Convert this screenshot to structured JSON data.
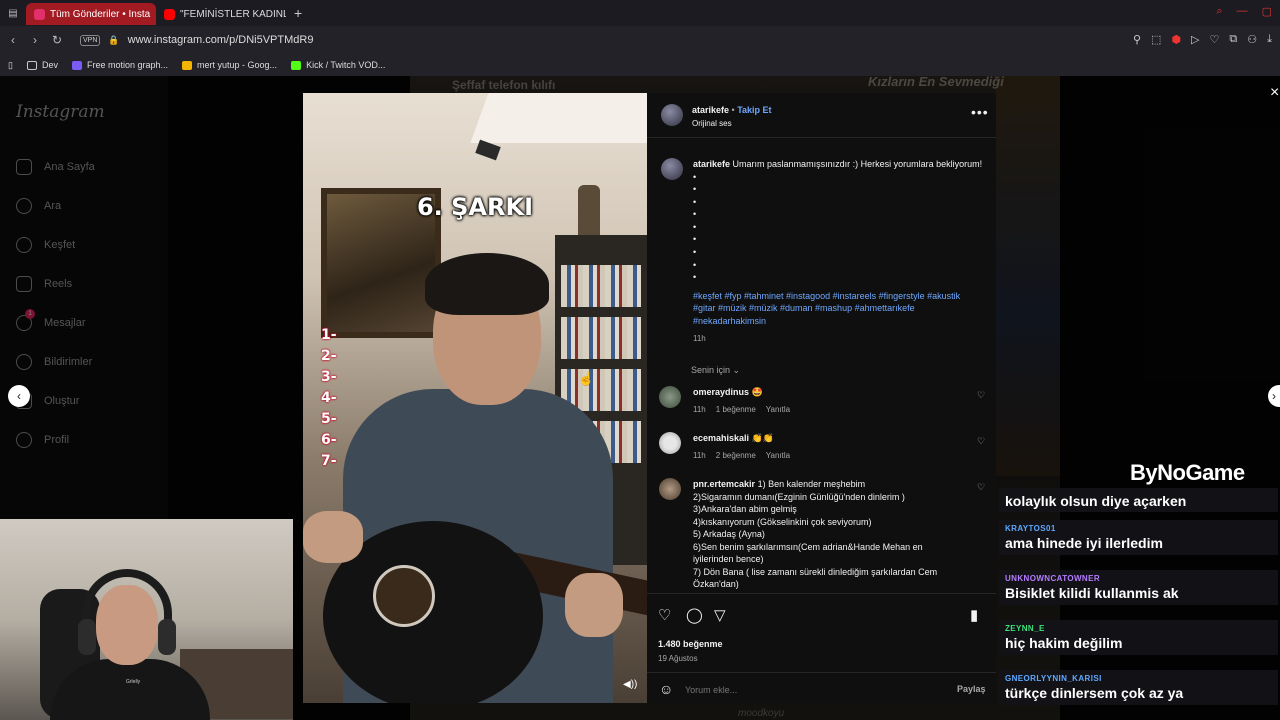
{
  "browser": {
    "tabs": [
      {
        "label": "Tüm Gönderiler • Insta",
        "active": true,
        "icon_color": "#e1306c"
      },
      {
        "label": "\"FEMİNİSTLER KADINLAR",
        "active": false,
        "icon_color": "#ff0000"
      }
    ],
    "new_tab": "+",
    "url": "www.instagram.com/p/DNi5VPTMdR9",
    "vpn": "VPN",
    "bookmarks": [
      {
        "label": "Dev",
        "icon_color": "#c9c9c9"
      },
      {
        "label": "Free motion graph...",
        "icon_color": "#7a5af8"
      },
      {
        "label": "mert yutup - Goog...",
        "icon_color": "#f4b400"
      },
      {
        "label": "Kick / Twitch VOD...",
        "icon_color": "#53fc18"
      }
    ]
  },
  "background": {
    "tile_text_1": "Şeffaf telefon kılıfı",
    "tile_text_2": "Kızların En Sevmediği",
    "tile_text_3": "moodkoyu"
  },
  "instagram": {
    "logo": "Instagram",
    "nav": [
      {
        "label": "Ana Sayfa",
        "icon": "home-icon"
      },
      {
        "label": "Ara",
        "icon": "search-icon"
      },
      {
        "label": "Keşfet",
        "icon": "compass-icon"
      },
      {
        "label": "Reels",
        "icon": "reels-icon"
      },
      {
        "label": "Mesajlar",
        "icon": "messenger-icon",
        "badge": "1"
      },
      {
        "label": "Bildirimler",
        "icon": "heart-icon"
      },
      {
        "label": "Oluştur",
        "icon": "plus-icon"
      },
      {
        "label": "Profil",
        "icon": "profile-icon"
      }
    ]
  },
  "video": {
    "title": "6. ŞARKI",
    "numbers": [
      "1-",
      "2-",
      "3-",
      "4-",
      "5-",
      "6-",
      "7-"
    ]
  },
  "post": {
    "username": "atarikefe",
    "dot": "•",
    "follow": "Takip Et",
    "audio": "Orijinal ses",
    "caption_text": "Umarım paslanmamışsınızdır :) Herkesi yorumlara bekliyorum!",
    "dots": [
      "•",
      "•",
      "•",
      "•",
      "•",
      "•",
      "•",
      "•",
      "•"
    ],
    "hashtags": "#keşfet #fyp #tahminet #instagood #instareels #fingerstyle #akustik #gitar #müzik #müzik #duman #mashup #ahmettarıkefe #nekadarhakimsin",
    "caption_time": "11h",
    "sort_label": "Senin için",
    "comments": [
      {
        "user": "omeraydinus",
        "text": "🤩",
        "time": "11h",
        "likes": "1 beğenme",
        "reply": "Yanıtla"
      },
      {
        "user": "ecemahiskali",
        "text": "👏👏",
        "time": "11h",
        "likes": "2 beğenme",
        "reply": "Yanıtla"
      },
      {
        "user": "pnr.ertemcakir",
        "text": "1) Ben kalender meşhebim\n2)Sigaramın dumanı(Ezginin Günlüğü'nden dinlerim )\n3)Ankara'dan abim gelmiş\n4)kıskanıyorum (Gökselinkini çok seviyorum)\n5) Arkadaş (Ayna)\n6)Sen benim şarkılarımsın(Cem adrian&Hande Mehan en iyilerinden bence)\n7) Dön Bana ( lise zamanı sürekli dinlediğim şarkılardan Cem Özkan'dan)"
      }
    ],
    "like_count": "1.480 beğenme",
    "date": "19 Ağustos",
    "comment_placeholder": "Yorum ekle...",
    "share_label": "Paylaş"
  },
  "chat": {
    "logo_prefix": "By",
    "logo_brand": "NoGame",
    "top_text": "kolaylık olsun diye açarken",
    "messages": [
      {
        "user": "KRAYTOS01",
        "text": "ama hinede iyi ilerledim",
        "color": "#5fa8ff"
      },
      {
        "user": "UNKNOWNCATOWNER",
        "text": "Bisiklet kilidi kullanmis ak",
        "color": "#b57cff"
      },
      {
        "user": "ZEYNN_E",
        "text": "hiç hakim değilim",
        "color": "#3fe07a"
      },
      {
        "user": "GNEORLYYNIN_KARISI",
        "text": "türkçe dinlersem çok az ya",
        "color": "#5fa8ff"
      }
    ]
  },
  "webcam": {
    "shirt_text": "Grlelly"
  }
}
